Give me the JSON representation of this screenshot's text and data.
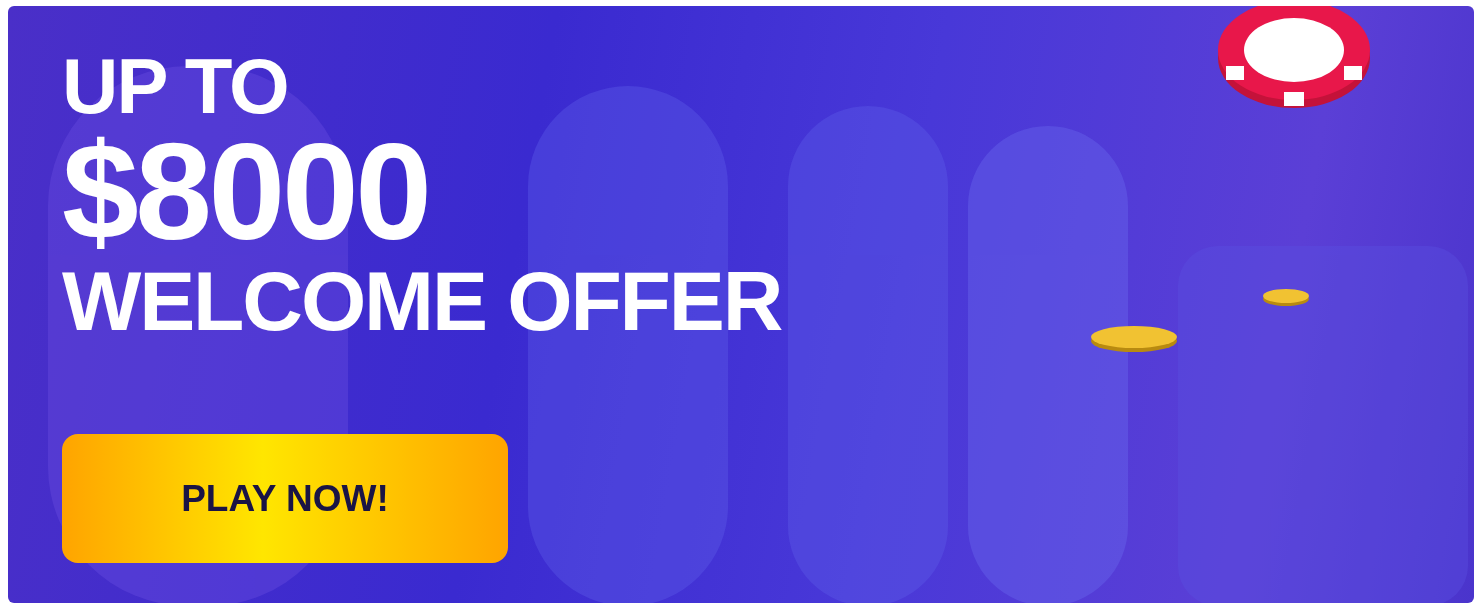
{
  "banner": {
    "headline": [
      "UP TO",
      "$8000",
      "WELCOME OFFER"
    ],
    "button": {
      "label": "PLAY NOW!"
    }
  }
}
